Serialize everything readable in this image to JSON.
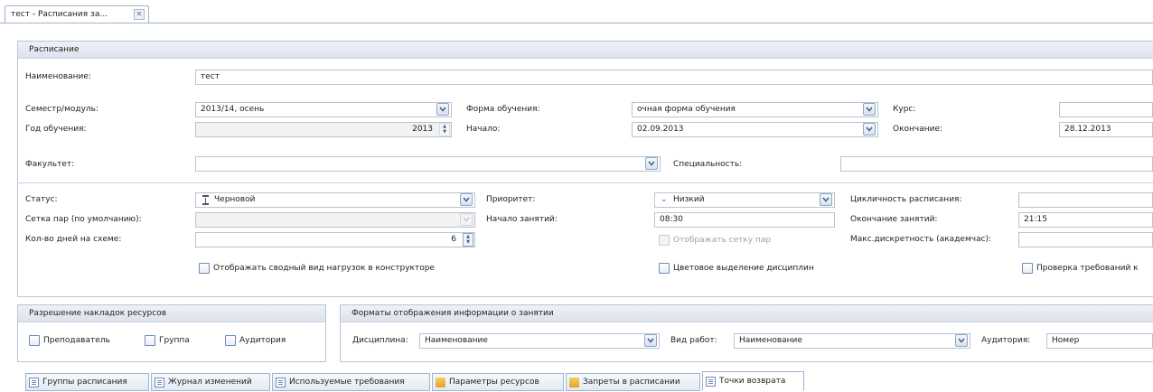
{
  "doc_tab": {
    "title": "тест - Расписания за..."
  },
  "schedule_panel": {
    "title": "Расписание"
  },
  "fields": {
    "name": {
      "label": "Наименование:",
      "value": "тест"
    },
    "semester": {
      "label": "Семестр/модуль:",
      "value": "2013/14, осень"
    },
    "study_form": {
      "label": "Форма обучения:",
      "value": "очная форма обучения"
    },
    "course": {
      "label": "Курс:",
      "value": ""
    },
    "year": {
      "label": "Год обучения:",
      "value": "2013"
    },
    "start": {
      "label": "Начало:",
      "value": "02.09.2013"
    },
    "end": {
      "label": "Окончание:",
      "value": "28.12.2013"
    },
    "faculty": {
      "label": "Факультет:",
      "value": ""
    },
    "speciality": {
      "label": "Специальность:",
      "value": ""
    },
    "status": {
      "label": "Статус:",
      "value": "Черновой"
    },
    "priority": {
      "label": "Приоритет:",
      "value": "Низкий"
    },
    "cyclicity": {
      "label": "Цикличность расписания:",
      "value": ""
    },
    "pair_grid": {
      "label": "Сетка пар (по умолчанию):",
      "value": ""
    },
    "lessons_start": {
      "label": "Начало занятий:",
      "value": "08:30"
    },
    "lessons_end": {
      "label": "Окончание занятий:",
      "value": "21:15"
    },
    "days_count": {
      "label": "Кол-во дней на схеме:",
      "value": "6"
    },
    "max_discreteness": {
      "label": "Макс.дискретность (академчас):",
      "value": ""
    }
  },
  "checkboxes": {
    "show_summary": "Отображать сводный вид нагрузок в конструкторе",
    "show_pair_grid": "Отображать сетку пар",
    "color_disciplines": "Цветовое выделение дисциплин",
    "check_requirements": "Проверка требований к"
  },
  "overlap_panel": {
    "title": "Разрешение накладок ресурсов",
    "teacher": "Преподаватель",
    "group": "Группа",
    "auditorium": "Аудитория"
  },
  "formats_panel": {
    "title": "Форматы отображения информации о занятии",
    "discipline_label": "Дисциплина:",
    "discipline_value": "Наименование",
    "work_label": "Вид работ:",
    "work_value": "Наименование",
    "aud_label": "Аудитория:",
    "aud_value": "Номер"
  },
  "bottom_tabs": [
    {
      "label": "Группы расписания"
    },
    {
      "label": "Журнал изменений"
    },
    {
      "label": "Используемые требования"
    },
    {
      "label": "Параметры ресурсов"
    },
    {
      "label": "Запреты в расписании"
    },
    {
      "label": "Точки возврата"
    }
  ],
  "colors": {
    "accent": "#9db3cf",
    "header_bg": "#dde3ec"
  }
}
